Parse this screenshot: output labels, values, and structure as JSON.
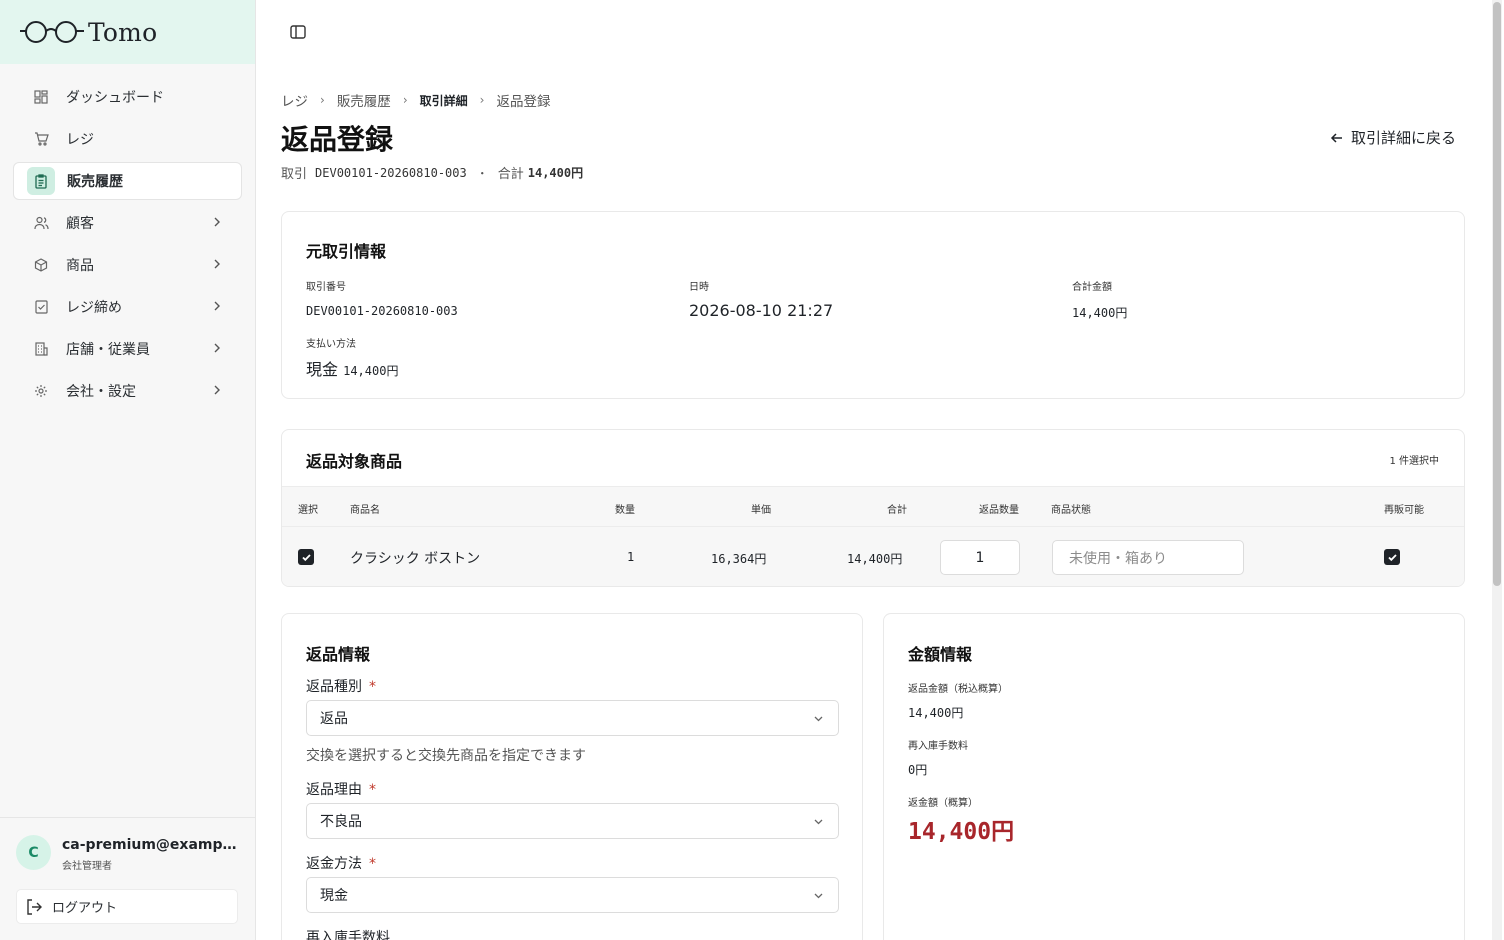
{
  "app": {
    "logo_text": "Tomo"
  },
  "sidebar": {
    "items": [
      {
        "label": "ダッシュボード",
        "icon": "dashboard-icon"
      },
      {
        "label": "レジ",
        "icon": "cart-icon"
      },
      {
        "label": "販売履歴",
        "icon": "receipt-icon",
        "active": true
      },
      {
        "label": "顧客",
        "icon": "users-icon"
      },
      {
        "label": "商品",
        "icon": "package-icon"
      },
      {
        "label": "レジ締め",
        "icon": "checklist-icon"
      },
      {
        "label": "店舗・従業員",
        "icon": "building-icon"
      },
      {
        "label": "会社・設定",
        "icon": "gear-icon"
      }
    ],
    "user": {
      "avatar_initial": "C",
      "email": "ca-premium@example.com",
      "role": "会社管理者"
    },
    "logout_label": "ログアウト"
  },
  "breadcrumb": [
    "レジ",
    "販売履歴",
    "取引詳細",
    "返品登録"
  ],
  "header": {
    "title": "返品登録",
    "transaction_prefix": "取引",
    "transaction_id": "DEV00101-20260810-003",
    "dot": "・",
    "total_prefix": "合計",
    "total": "14,400円",
    "back_label": "取引詳細に戻る"
  },
  "original": {
    "title": "元取引情報",
    "number_label": "取引番号",
    "number": "DEV00101-20260810-003",
    "datetime_label": "日時",
    "datetime": "2026-08-10 21:27",
    "total_label": "合計金額",
    "total": "14,400円",
    "payment_label": "支払い方法",
    "payment_method": "現金",
    "payment_amount": "14,400円"
  },
  "items": {
    "title": "返品対象商品",
    "selected_count": "1 件選択中",
    "columns": {
      "select": "選択",
      "name": "商品名",
      "qty": "数量",
      "unit_price": "単価",
      "total": "合計",
      "return_qty": "返品数量",
      "condition": "商品状態",
      "resellable": "再販可能"
    },
    "rows": [
      {
        "selected": true,
        "name": "クラシック ボストン",
        "qty": "1",
        "unit_price": "16,364円",
        "total": "14,400円",
        "return_qty": "1",
        "condition_placeholder": "未使用・箱あり",
        "resellable": true
      }
    ]
  },
  "return_info": {
    "title": "返品情報",
    "type_label": "返品種別",
    "type_value": "返品",
    "type_hint": "交換を選択すると交換先商品を指定できます",
    "reason_label": "返品理由",
    "reason_value": "不良品",
    "refund_method_label": "返金方法",
    "refund_method_value": "現金",
    "restock_fee_label": "再入庫手数料",
    "required_mark": "*"
  },
  "amount_info": {
    "title": "金額情報",
    "return_amount_label": "返品金額（税込概算）",
    "return_amount": "14,400円",
    "restock_fee_label": "再入庫手数料",
    "restock_fee": "0円",
    "refund_label": "返金額（概算）",
    "refund_amount": "14,400円"
  },
  "colors": {
    "accent": "#1a8a66",
    "refund": "#a8262b",
    "logo_bg": "#e3f6ef"
  }
}
